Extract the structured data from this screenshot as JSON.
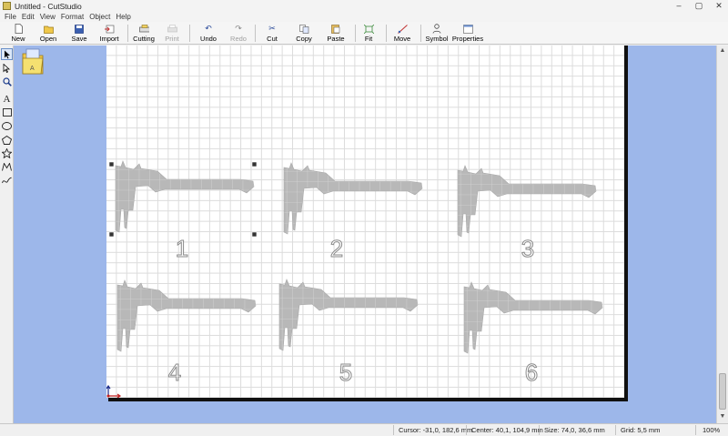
{
  "window": {
    "title": "Untitled - CutStudio",
    "controls": [
      "–",
      "▢",
      "✕"
    ]
  },
  "menu": [
    "File",
    "Edit",
    "View",
    "Format",
    "Object",
    "Help"
  ],
  "toolbar": [
    {
      "label": "New",
      "icon": "new-document-icon"
    },
    {
      "label": "Open",
      "icon": "open-folder-icon"
    },
    {
      "label": "Save",
      "icon": "save-disk-icon"
    },
    {
      "label": "Import",
      "icon": "import-icon"
    },
    {
      "label": "Cutting",
      "icon": "cutting-plotter-icon"
    },
    {
      "label": "Print",
      "icon": "printer-icon",
      "disabled": true
    },
    {
      "label": "Undo",
      "icon": "undo-icon"
    },
    {
      "label": "Redo",
      "icon": "redo-icon",
      "disabled": true
    },
    {
      "label": "Cut",
      "icon": "scissors-icon"
    },
    {
      "label": "Copy",
      "icon": "copy-icon"
    },
    {
      "label": "Paste",
      "icon": "paste-icon"
    },
    {
      "label": "Fit",
      "icon": "fit-icon"
    },
    {
      "label": "Move",
      "icon": "move-icon"
    },
    {
      "label": "Symbol",
      "icon": "symbol-icon"
    },
    {
      "label": "Properties",
      "icon": "properties-icon"
    }
  ],
  "tools": [
    "select-arrow-icon",
    "node-edit-arrow-icon",
    "zoom-icon",
    "text-tool-icon",
    "rectangle-icon",
    "ellipse-icon",
    "polygon-icon",
    "star-icon",
    "polyline-icon",
    "curve-icon"
  ],
  "canvas": {
    "labels": [
      "1",
      "2",
      "3",
      "4",
      "5",
      "6"
    ],
    "grid_color": "#dcdcdc",
    "shape_fill": "#b8b8b8",
    "workspace_color": "#9db7ea"
  },
  "status": {
    "cursor": "Cursor: -31,0, 182,6 mm",
    "center": "Center: 40,1, 104,9 mm",
    "size": "Size: 74,0, 36,6 mm",
    "grid": "Grid: 5,5 mm",
    "zoom": "100%"
  }
}
